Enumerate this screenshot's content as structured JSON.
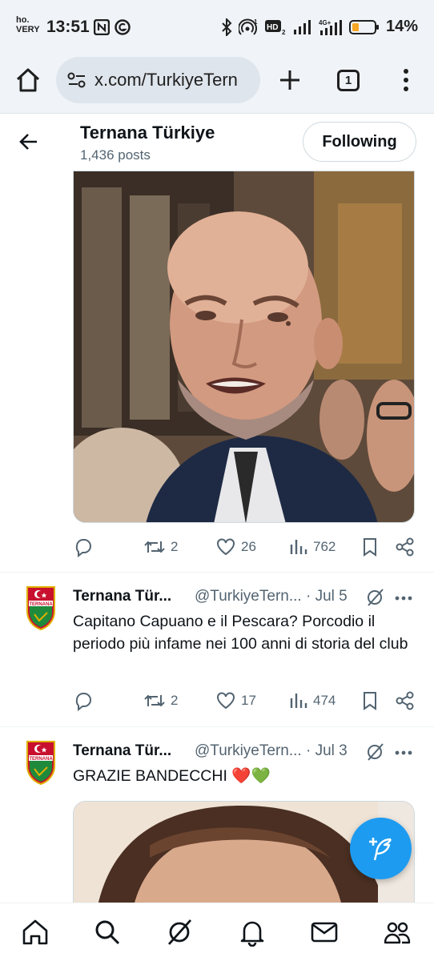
{
  "status_bar": {
    "carrier_line1": "ho.",
    "carrier_line2": "VERY",
    "time": "13:51",
    "battery": "14%",
    "network_label": "4G+"
  },
  "browser": {
    "url": "x.com/TurkiyeTern",
    "tab_count": "1"
  },
  "profile": {
    "name": "Ternana Türkiye",
    "posts": "1,436 posts",
    "follow_button": "Following"
  },
  "tweets": [
    {
      "media": "photo",
      "stats": {
        "retweets": "2",
        "likes": "26",
        "views": "762"
      }
    },
    {
      "author": "Ternana Tür...",
      "handle": "@TurkiyeTern...",
      "separator": "·",
      "date": "Jul 5",
      "text": "Capitano Capuano e il Pescara? Porcodio il periodo più infame nei 100 anni di storia del club",
      "stats": {
        "retweets": "2",
        "likes": "17",
        "views": "474"
      }
    },
    {
      "author": "Ternana Tür...",
      "handle": "@TurkiyeTern...",
      "separator": "·",
      "date": "Jul 3",
      "text": "GRAZIE BANDECCHI ❤️💚",
      "media": "photo"
    }
  ],
  "avatar_text": "TERNANA",
  "colors": {
    "accent_blue": "#1d9bf0",
    "text_primary": "#0f1419",
    "text_secondary": "#536471",
    "browser_bg": "#f0f4f9",
    "ternana_red": "#c8102e",
    "ternana_green": "#1f8a3b"
  },
  "icons": {
    "nav": [
      "home-icon",
      "search-icon",
      "grok-icon",
      "notifications-icon",
      "messages-icon",
      "communities-icon"
    ],
    "tweet_actions": [
      "reply-icon",
      "retweet-icon",
      "like-icon",
      "views-icon",
      "bookmark-icon",
      "share-icon"
    ]
  }
}
